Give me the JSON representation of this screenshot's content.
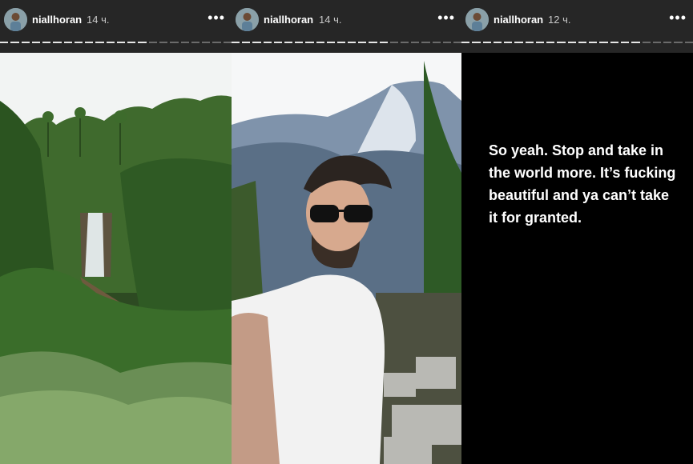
{
  "stories": [
    {
      "username": "niallhoran",
      "time": "14 ч.",
      "more_icon": "•••"
    },
    {
      "username": "niallhoran",
      "time": "14 ч.",
      "more_icon": "•••"
    },
    {
      "username": "niallhoran",
      "time": "12 ч.",
      "more_icon": "•••",
      "text": "So yeah. Stop and take in the world more. It’s fucking beautiful and ya can’t take it for granted."
    }
  ],
  "colors": {
    "header_bg": "#262626",
    "progress_done": "#e6e6e6",
    "progress_pending": "#6b6b6b"
  }
}
